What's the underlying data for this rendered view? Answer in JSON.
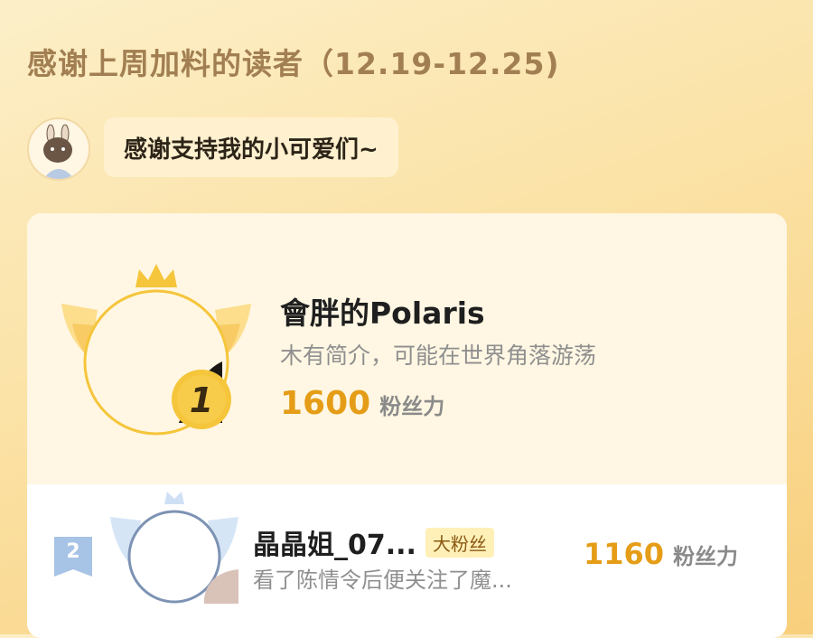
{
  "page": {
    "title": "感谢上周加料的读者（12.19-12.25)"
  },
  "author": {
    "avatar_icon": "author-avatar",
    "message": "感谢支持我的小可爱们~"
  },
  "ranking": [
    {
      "rank": "1",
      "name": "會胖的Polaris",
      "bio": "木有简介，可能在世界角落游荡",
      "score": "1600",
      "unit": "粉丝力",
      "badge_icon": "gold-crown-wing-badge"
    },
    {
      "rank": "2",
      "name": "晶晶姐_07...",
      "tag": "大粉丝",
      "bio": "看了陈情令后便关注了魔...",
      "score": "1160",
      "unit": "粉丝力",
      "badge_icon": "silver-crown-wing-badge"
    }
  ],
  "colors": {
    "accent": "#e59d17",
    "title": "#a27f52",
    "gold": "#f5c53b",
    "silver": "#a7c3e5"
  }
}
